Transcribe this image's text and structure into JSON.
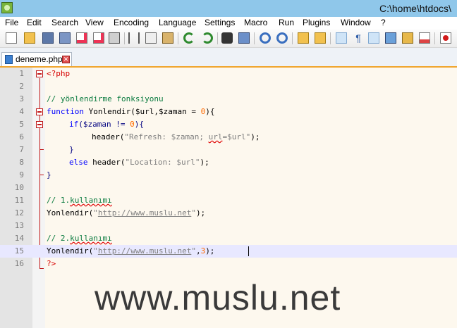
{
  "window": {
    "title": "C:\\home\\htdocs\\"
  },
  "menu": [
    "File",
    "Edit",
    "Search",
    "View",
    "Encoding",
    "Language",
    "Settings",
    "Macro",
    "Run",
    "Plugins",
    "Window",
    "?"
  ],
  "toolbar": {
    "icons": [
      "new-file-icon",
      "open-file-icon",
      "save-icon",
      "save-all-icon",
      "close-icon",
      "close-all-icon",
      "print-icon",
      "cut-icon",
      "copy-icon",
      "paste-icon",
      "undo-icon",
      "redo-icon",
      "find-icon",
      "replace-icon",
      "zoom-in-icon",
      "zoom-out-icon",
      "sync-vertical-icon",
      "sync-horizontal-icon",
      "word-wrap-icon",
      "show-all-chars-icon",
      "indent-guide-icon",
      "document-map-icon",
      "folder-icon",
      "function-list-icon",
      "record-macro-icon"
    ]
  },
  "tab": {
    "label": "deneme.php",
    "close_symbol": "✕"
  },
  "editor": {
    "lines": [
      {
        "n": "1"
      },
      {
        "n": "2"
      },
      {
        "n": "3"
      },
      {
        "n": "4"
      },
      {
        "n": "5"
      },
      {
        "n": "6"
      },
      {
        "n": "7"
      },
      {
        "n": "8"
      },
      {
        "n": "9"
      },
      {
        "n": "10"
      },
      {
        "n": "11"
      },
      {
        "n": "12"
      },
      {
        "n": "13"
      },
      {
        "n": "14"
      },
      {
        "n": "15"
      },
      {
        "n": "16"
      }
    ],
    "code": {
      "l1_open": "<?php",
      "l3_comment": "// yönlendirme fonksiyonu",
      "l4_kw": "function",
      "l4_name": " Yonlendir(",
      "l4_args": "$url,$zaman",
      "l4_eq": " = ",
      "l4_num": "0",
      "l4_end": "){",
      "l5_kw": "if",
      "l5_open": "(",
      "l5_var": "$zaman",
      "l5_op": " != ",
      "l5_num": "0",
      "l5_end": "){",
      "l6_fn": "header(",
      "l6_str1": "\"Refresh: $zaman; ",
      "l6_str2": "url",
      "l6_str3": "=$url\"",
      "l6_end": ");",
      "l7_close": "}",
      "l8_kw": "else",
      "l8_fn": " header(",
      "l8_str": "\"Location: $url\"",
      "l8_end": ");",
      "l9_close": "}",
      "l11_prefix": "// 1.",
      "l11_word": "kullanımı",
      "l12_fn": "Yonlendir(",
      "l12_str1": "\"",
      "l12_link": "http://www.muslu.net",
      "l12_str2": "\"",
      "l12_end": ");",
      "l14_prefix": "// 2.",
      "l14_word": "kullanımı",
      "l15_fn": "Yonlendir(",
      "l15_str1": "\"",
      "l15_link": "http://www.muslu.net",
      "l15_str2": "\"",
      "l15_comma": ",",
      "l15_num": "3",
      "l15_end": ");",
      "l16_close": "?>"
    }
  },
  "watermark": "www.muslu.net"
}
